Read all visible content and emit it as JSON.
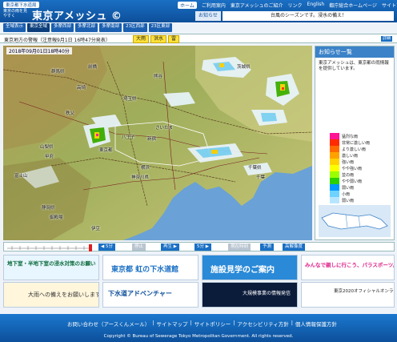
{
  "header": {
    "bureau": "東京都下水道局",
    "tagline": "東京の雨を見やすく",
    "app_title": "東京アメッシュ ©",
    "nav": [
      "ホーム",
      "ご利用案内",
      "東京アメッシュのご紹介",
      "リンク",
      "English",
      "都庁総合ホームページ",
      "サイトマップ"
    ],
    "notice_label": "お知らせ",
    "notice_text": "台風のシーズンです。浸水の備え！"
  },
  "regions": [
    "全域表示",
    "東京全域",
    "多摩西部",
    "多摩北部",
    "多摩南部",
    "23区西部",
    "23区東部"
  ],
  "warning": {
    "text": "東京地方の警報（注意報9月1日 16時47分発表）",
    "tags": [
      "大雨",
      "洪水",
      "雷"
    ],
    "detail": "詳細"
  },
  "map": {
    "timestamp": "2018年09月01日18時40分",
    "places": [
      "群馬県",
      "前橋",
      "熊谷",
      "高崎",
      "秩父",
      "埼玉県",
      "さいたま",
      "茨城県",
      "山梨県",
      "甲府",
      "八王子",
      "東京都",
      "新宿",
      "横浜",
      "神奈川県",
      "千葉県",
      "千葉",
      "静岡県",
      "富士山",
      "御殿場",
      "伊豆"
    ]
  },
  "side": {
    "title": "お知らせ一覧",
    "body": "東京アメッシュは、東京都の雨情報を提供しています。",
    "legend": [
      {
        "label": "猛烈な雨",
        "color": "#ff1493"
      },
      {
        "label": "非常に激しい雨",
        "color": "#ff2a00"
      },
      {
        "label": "より激しい雨",
        "color": "#ff6a00"
      },
      {
        "label": "激しい雨",
        "color": "#ffa200"
      },
      {
        "label": "強い雨",
        "color": "#ffd200"
      },
      {
        "label": "やや強い雨",
        "color": "#fbff00"
      },
      {
        "label": "並の雨",
        "color": "#9bff00"
      },
      {
        "label": "やや弱い雨",
        "color": "#2ad100"
      },
      {
        "label": "弱い雨",
        "color": "#0099ff"
      },
      {
        "label": "小雨",
        "color": "#6fd3ff"
      },
      {
        "label": "弱い雨",
        "color": "#b6e6ff"
      }
    ]
  },
  "timebar": {
    "prev": "◀ 5分",
    "stop": "停止",
    "play": "再生 ▶",
    "next": "5分 ▶",
    "now": "現在時刻",
    "forecast": "予測",
    "high": "高解像度"
  },
  "banners": {
    "b1_title": "地下室・半地下室の浸水対策のお願い",
    "b1_sub": "大雨への備えをお願いします。",
    "b2_title": "東京都 虹の下水道館",
    "b2_sub": "下水道アドベンチャー",
    "b3_title": "施設見学のご案内",
    "b3_sub": "大規模事業の情報発信",
    "b4_title": "みんなで親しに行こう、パラスポーツ。",
    "b4_sub": "東京2020オフィシャルオンラインショップ"
  },
  "footer": {
    "links": [
      "お問い合わせ（アースくんメール）",
      "|",
      "サイトマップ",
      "|",
      "サイトポリシー",
      "|",
      "アクセシビリティ方針",
      "|",
      "個人情報保護方針"
    ],
    "copyright": "Copyright © Bureau of Sewerage Tokyo Metropolitan Government. All rights reserved."
  }
}
